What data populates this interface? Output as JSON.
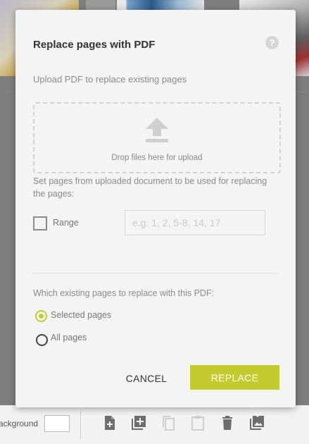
{
  "modal": {
    "title": "Replace pages with PDF",
    "help_icon_glyph": "?",
    "upload_hint": "Upload PDF to replace existing pages",
    "dropzone_text": "Drop files here for upload",
    "set_pages_text": "Set pages from uploaded document to be used for replacing the pages:",
    "range_label": "Range",
    "range_placeholder": "e.g. 1, 2, 5-8, 14, 17",
    "range_value": "",
    "which_pages_label": "Which existing pages to replace with this PDF:",
    "options": [
      {
        "label": "Selected pages",
        "selected": true
      },
      {
        "label": "All pages",
        "selected": false
      }
    ],
    "cancel_label": "CANCEL",
    "replace_label": "REPLACE"
  },
  "toolbar": {
    "background_label": "ackground",
    "icons": [
      "add-page-icon",
      "add-blank-page-icon",
      "copy-icon",
      "paste-icon",
      "trash-icon",
      "replace-image-icon"
    ]
  },
  "colors": {
    "accent": "#c3cb2f",
    "modal_bg": "#f4f4f4",
    "overlay": "#7e7e7e"
  }
}
